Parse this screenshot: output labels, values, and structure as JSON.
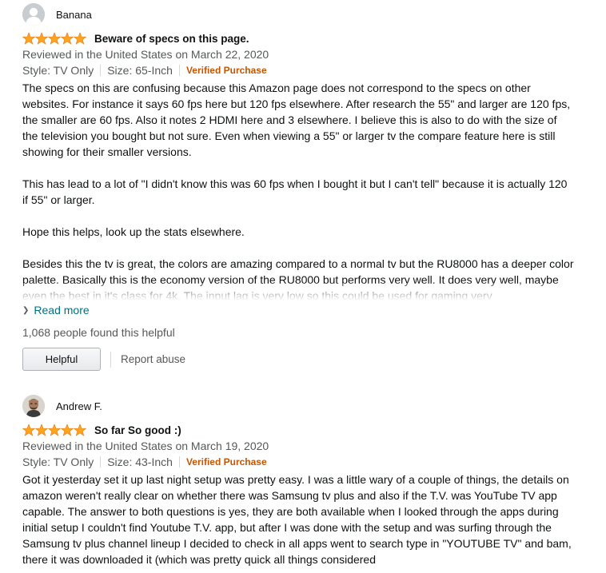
{
  "colors": {
    "star": "#ffa41c",
    "verified": "#c45500",
    "link": "#007185",
    "meta": "#565959"
  },
  "reviews": [
    {
      "reviewer": "Banana",
      "avatar_icon": "default-profile-icon",
      "rating": 5,
      "max_rating": 5,
      "title": "Beware of specs on this page.",
      "reviewed_in": "Reviewed in the United States on March 22, 2020",
      "style": "Style: TV Only",
      "size": "Size: 65-Inch",
      "verified": "Verified Purchase",
      "paragraphs": [
        "The specs on this are confusing because this Amazon page does not correspond to the specs on other websites. For instance it says 60 fps here but 120 fps elsewhere. After research the 55\" and larger are 120 fps, the smaller are 60 fps. Also it notes 2 HDMI here and 3 elsewhere. I believe this is also to do with the size of the television you bought but not sure. Even when viewing a 55\" or larger tv the compare feature here is still showing for their smaller versions.",
        "This has lead to a lot of \"I didn't know this was 60 fps when I bought it but I can't tell\" because it is actually 120 if 55\" or larger.",
        "Hope this helps, look up the stats elsewhere.",
        "Besides this the tv is great, the colors are amazing compared to a normal tv but the RU8000 has a deeper color palette. Basically this is the economy version of the RU8000 but performs very well. It does very well, maybe even the best in it's class for 4k. The input lag is very low so this could be used for gaming very"
      ],
      "read_more": "Read more",
      "helpful_count": "1,068 people found this helpful",
      "helpful_button": "Helpful",
      "report_abuse": "Report abuse"
    },
    {
      "reviewer": "Andrew F.",
      "avatar_icon": "user-photo",
      "rating": 5,
      "max_rating": 5,
      "title": "So far So good :)",
      "reviewed_in": "Reviewed in the United States on March 19, 2020",
      "style": "Style: TV Only",
      "size": "Size: 43-Inch",
      "verified": "Verified Purchase",
      "paragraphs": [
        "Got it yesterday set it up last night setup was pretty easy. I was a little wary of a couple of things, the details on amazon weren't really clear on whether there was Samsung tv plus and also if the T.V. was YouTube TV app capable. The answer to both questions is yes, they are both available when I looked through the apps during initial setup I couldn't find Youtube T.V. app, but after I was done with the setup and was surfing through the Samsung tv plus channel lineup I decided to check in all apps went to search type in \"YOUTUBE TV\" and bam, there it was downloaded it (which was pretty quick all things considered"
      ]
    }
  ]
}
